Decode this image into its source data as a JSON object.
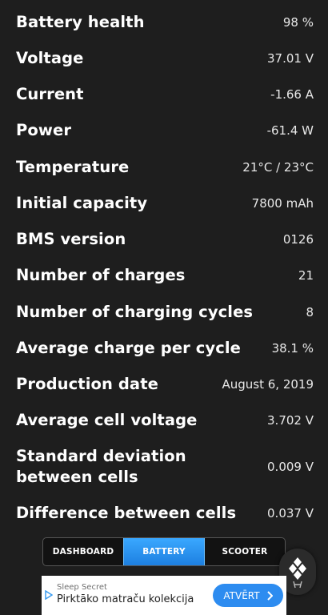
{
  "stats": [
    {
      "label": "Battery health",
      "value": "98 %"
    },
    {
      "label": "Voltage",
      "value": "37.01 V"
    },
    {
      "label": "Current",
      "value": "-1.66 A"
    },
    {
      "label": "Power",
      "value": "-61.4 W"
    },
    {
      "label": "Temperature",
      "value": "21°C / 23°C"
    },
    {
      "label": "Initial capacity",
      "value": "7800 mAh"
    },
    {
      "label": "BMS version",
      "value": "0126"
    },
    {
      "label": "Number of charges",
      "value": "21"
    },
    {
      "label": "Number of charging cycles",
      "value": "8"
    },
    {
      "label": "Average charge per cycle",
      "value": "38.1 %"
    },
    {
      "label": "Production date",
      "value": "August 6, 2019"
    },
    {
      "label": "Average cell voltage",
      "value": "3.702 V"
    },
    {
      "label": "Standard deviation between cells",
      "value": "0.009 V"
    },
    {
      "label": "Difference between cells",
      "value": "0.037 V"
    }
  ],
  "tabs": [
    {
      "label": "DASHBOARD",
      "active": false
    },
    {
      "label": "BATTERY",
      "active": true
    },
    {
      "label": "SCOOTER",
      "active": false
    }
  ],
  "fab": {
    "icon": "diamond-logo-icon"
  },
  "ad": {
    "brand": "Sleep Secret",
    "title": "Pirktāko matraču kolekcija",
    "cta_label": "ATVĒRT",
    "icons": [
      "play-triangle-icon",
      "chevron-right-icon"
    ]
  },
  "colors": {
    "background": "#1e1e1e",
    "accent": "#2d8cf0"
  }
}
